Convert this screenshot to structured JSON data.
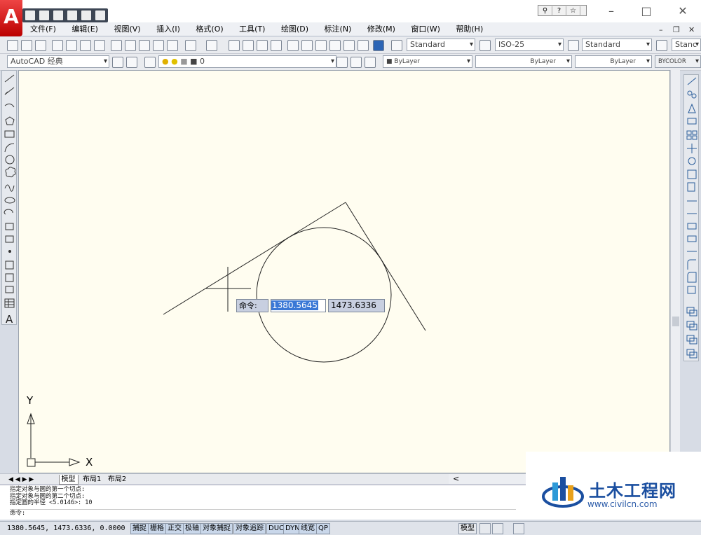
{
  "menu": [
    "文件(F)",
    "编辑(E)",
    "视图(V)",
    "插入(I)",
    "格式(O)",
    "工具(T)",
    "绘图(D)",
    "标注(N)",
    "修改(M)",
    "窗口(W)",
    "帮助(H)"
  ],
  "toolbar1": {
    "text_style": "Standard",
    "dim_style": "ISO-25",
    "table_style": "Standard",
    "multileader_style": "Stanc"
  },
  "toolbar2": {
    "workspace": "AutoCAD 经典",
    "layer": "0",
    "color": "ByLayer",
    "linetype": "ByLayer",
    "lineweight": "ByLayer",
    "plotstyle": "BYCOLOR"
  },
  "dynamic_input": {
    "label": "命令:",
    "x_value": "1380.5645",
    "y_value": "1473.6336"
  },
  "ucs": {
    "x_label": "X",
    "y_label": "Y"
  },
  "tabs": [
    "模型",
    "布局1",
    "布局2"
  ],
  "command_history": [
    "指定对象与圆的第一个切点:",
    "指定对象与圆的第二个切点:",
    "指定圆的半径 <5.0146>: 10"
  ],
  "command_prompt": "命令:",
  "status": {
    "coords": "1380.5645, 1473.6336, 0.0000",
    "buttons": [
      "捕捉",
      "栅格",
      "正交",
      "极轴",
      "对象捕捉",
      "对象追踪",
      "DUCS",
      "DYN",
      "线宽",
      "QP"
    ],
    "model_label": "模型"
  },
  "watermark": {
    "title": "土木工程网",
    "url": "www.civilcn.com"
  }
}
